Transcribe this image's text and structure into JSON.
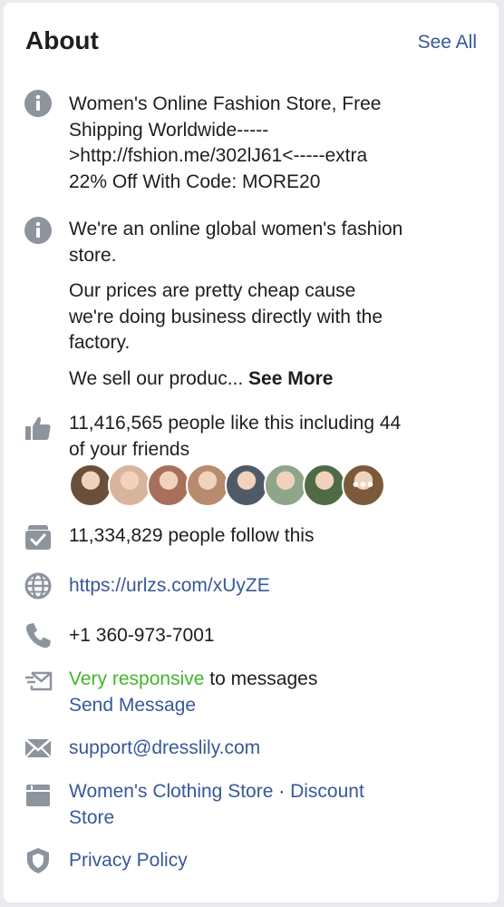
{
  "about": {
    "title": "About",
    "see_all": "See All"
  },
  "description": {
    "icon": "info-icon",
    "line1": "Women's Online Fashion Store, Free",
    "line2": "Shipping Worldwide-----",
    "line3": ">http://fshion.me/302lJ61<-----extra",
    "line4": "22% Off With Code: MORE20"
  },
  "story": {
    "icon": "info-icon",
    "para1_line1": "We're an online global women's fashion",
    "para1_line2": "store.",
    "para2_line1": "Our prices are pretty cheap cause",
    "para2_line2": "we're doing business directly with the",
    "para2_line3": "factory.",
    "para3_text": "We sell our produc...",
    "see_more": "See More"
  },
  "likes": {
    "icon": "thumbs-up-icon",
    "line1": "11,416,565 people like this including 44",
    "line2": "of your friends",
    "friend_avatars": [
      {
        "color": "#6b4f3a"
      },
      {
        "color": "#d9b49c"
      },
      {
        "color": "#a8705a"
      },
      {
        "color": "#b88a6e"
      },
      {
        "color": "#505a66"
      },
      {
        "color": "#8fa58a"
      },
      {
        "color": "#4f6b45"
      },
      {
        "color": "#7a5a3a"
      }
    ],
    "more_label": "•••"
  },
  "follows": {
    "icon": "follow-check-icon",
    "text": "11,334,829 people follow this"
  },
  "website": {
    "icon": "globe-icon",
    "url": "https://urlzs.com/xUyZE"
  },
  "phone": {
    "icon": "phone-icon",
    "number": "+1 360-973-7001"
  },
  "messaging": {
    "icon": "message-icon",
    "responsive": "Very responsive",
    "suffix": " to messages",
    "send_message": "Send Message"
  },
  "email": {
    "icon": "envelope-icon",
    "address": "support@dresslily.com"
  },
  "category": {
    "icon": "category-icon",
    "line1_a": "Women's Clothing Store",
    "separator": " · ",
    "line1_b": "Discount",
    "line2": "Store"
  },
  "privacy": {
    "icon": "shield-icon",
    "label": "Privacy Policy"
  }
}
